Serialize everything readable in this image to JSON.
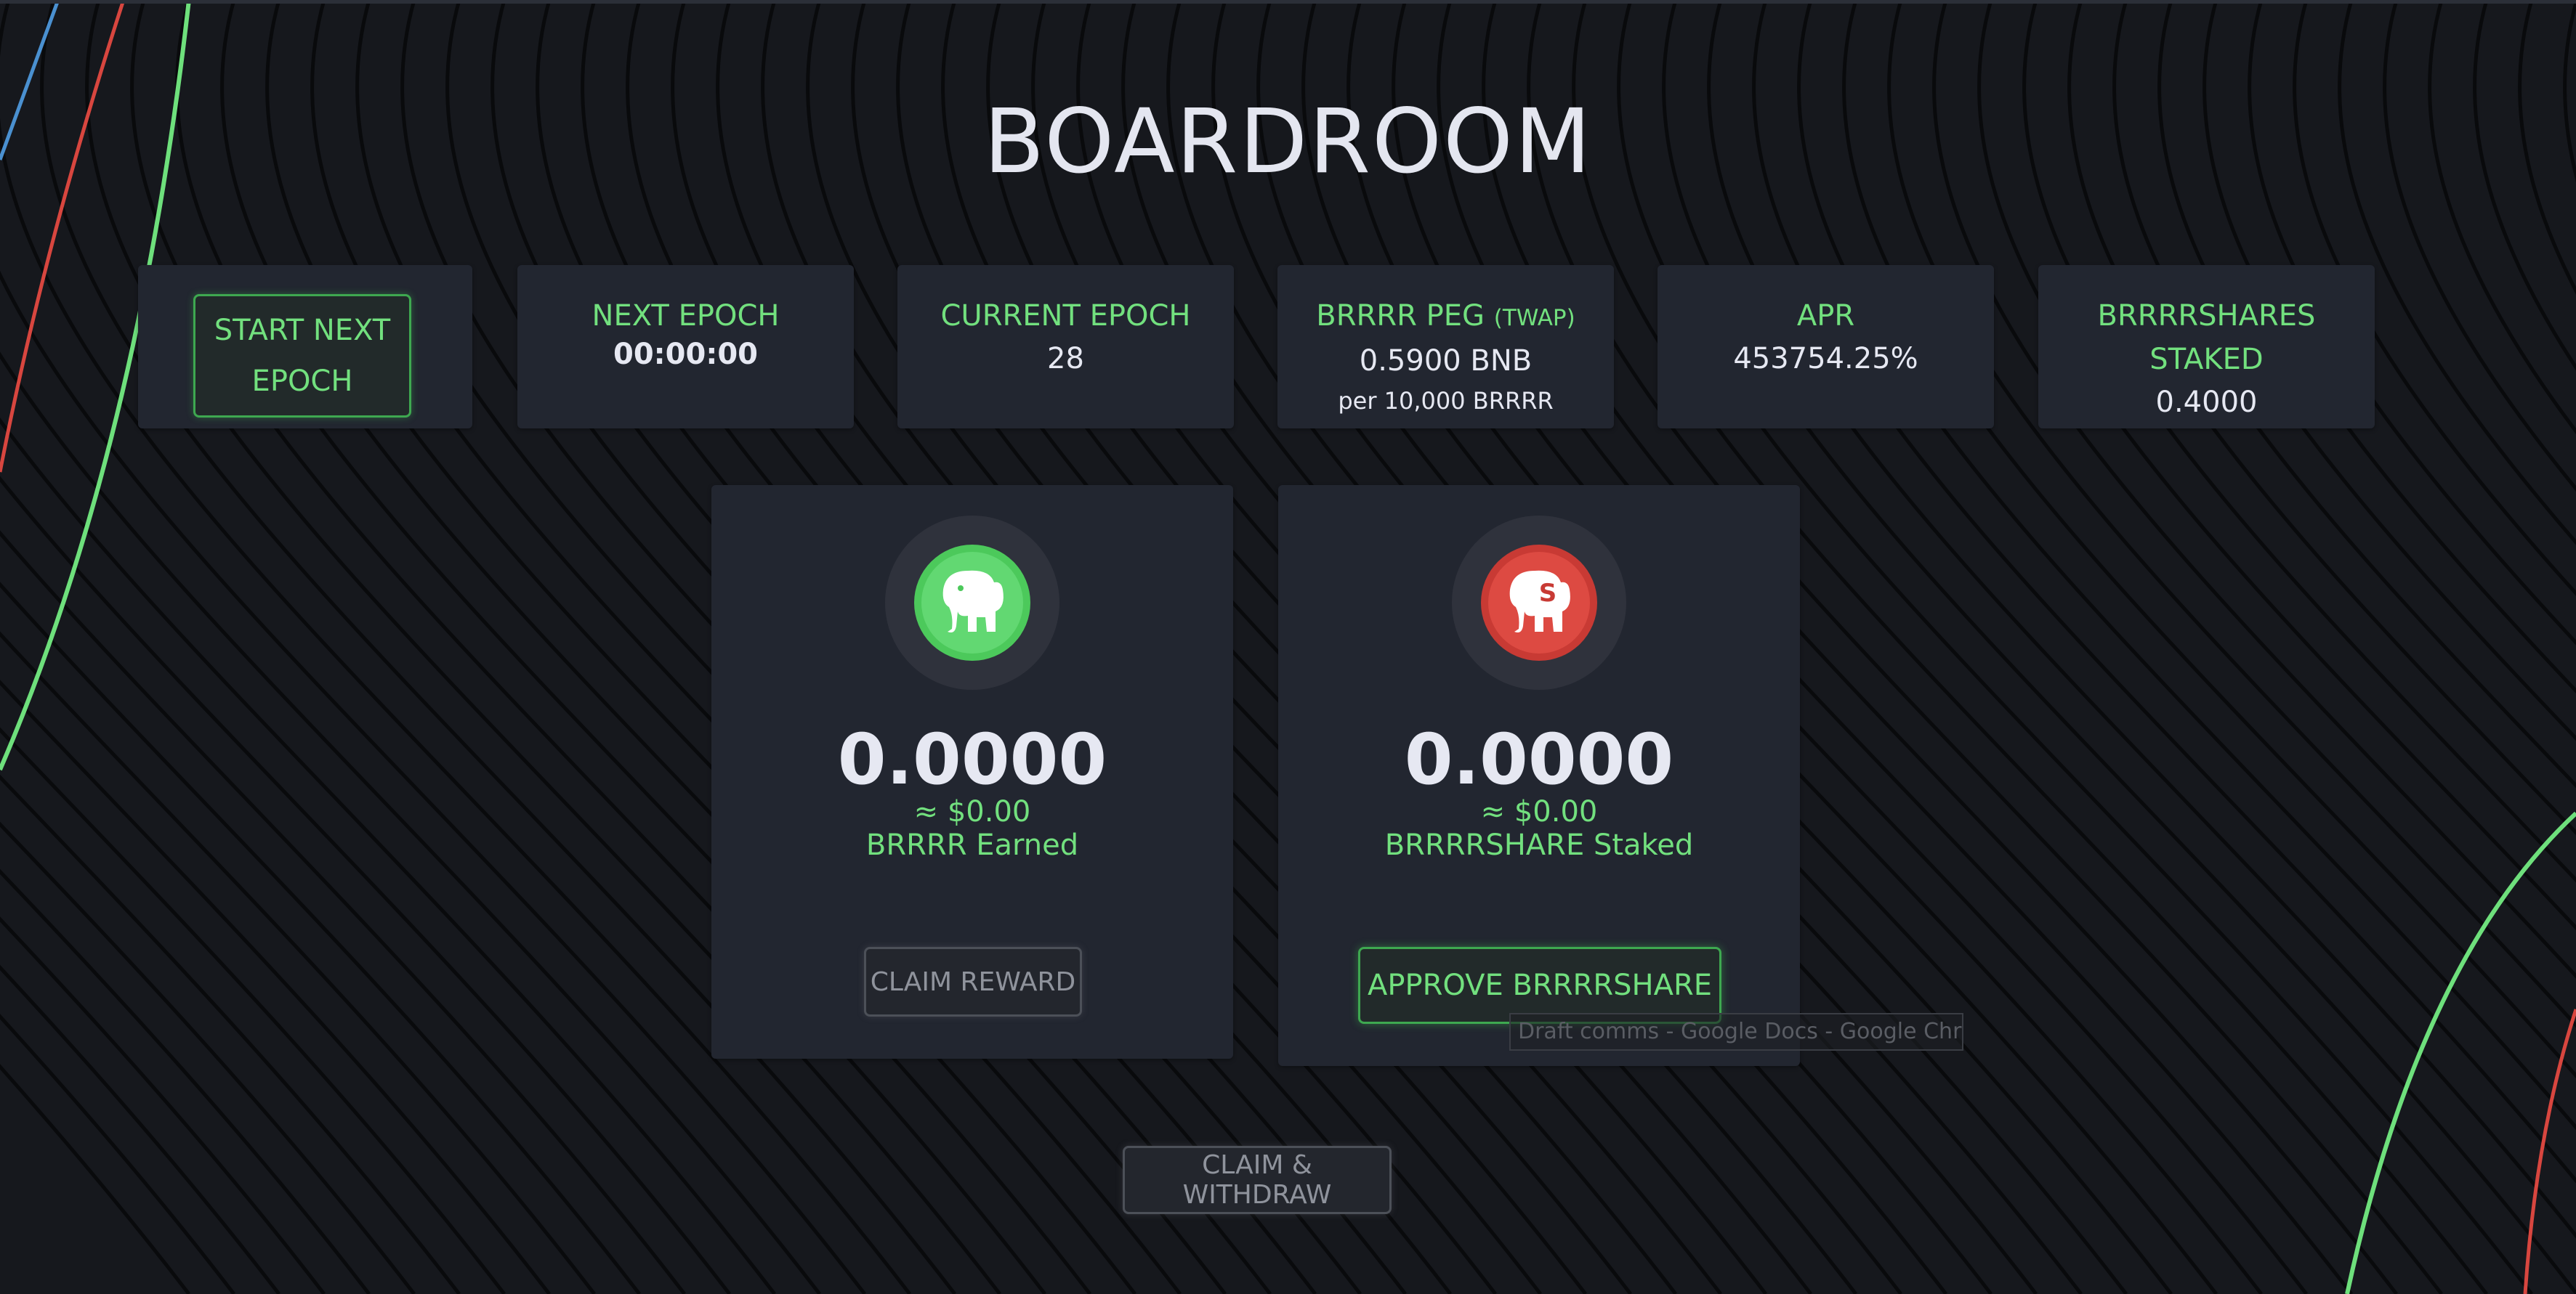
{
  "page": {
    "title": "BOARDROOM"
  },
  "stats": {
    "start_button_label": "START NEXT EPOCH",
    "next_epoch": {
      "label": "NEXT EPOCH",
      "value": "00:00:00"
    },
    "current_epoch": {
      "label": "CURRENT EPOCH",
      "value": "28"
    },
    "peg": {
      "label": "BRRRR PEG",
      "label_suffix": "(TWAP)",
      "value": "0.5900 BNB",
      "note": "per 10,000 BRRRR"
    },
    "apr": {
      "label": "APR",
      "value": "453754.25%"
    },
    "staked": {
      "label": "BRRRRSHARES STAKED",
      "value": "0.4000"
    }
  },
  "earned_card": {
    "icon": "elephant-green-token-icon",
    "amount": "0.0000",
    "usd": "≈ $0.00",
    "label": "BRRRR Earned",
    "button_label": "CLAIM REWARD"
  },
  "staked_card": {
    "icon": "elephant-red-share-token-icon",
    "amount": "0.0000",
    "usd": "≈ $0.00",
    "label": "BRRRRSHARE Staked",
    "button_label": "APPROVE BRRRRSHARE"
  },
  "footer": {
    "claim_withdraw_label": "CLAIM & WITHDRAW"
  },
  "tooltip": {
    "text": "Draft comms - Google Docs - Google Chrome"
  },
  "colors": {
    "background": "#16181d",
    "card": "#222630",
    "accent_green": "#72e07e",
    "accent_red": "#d8463f",
    "text": "#e6e8f2"
  }
}
